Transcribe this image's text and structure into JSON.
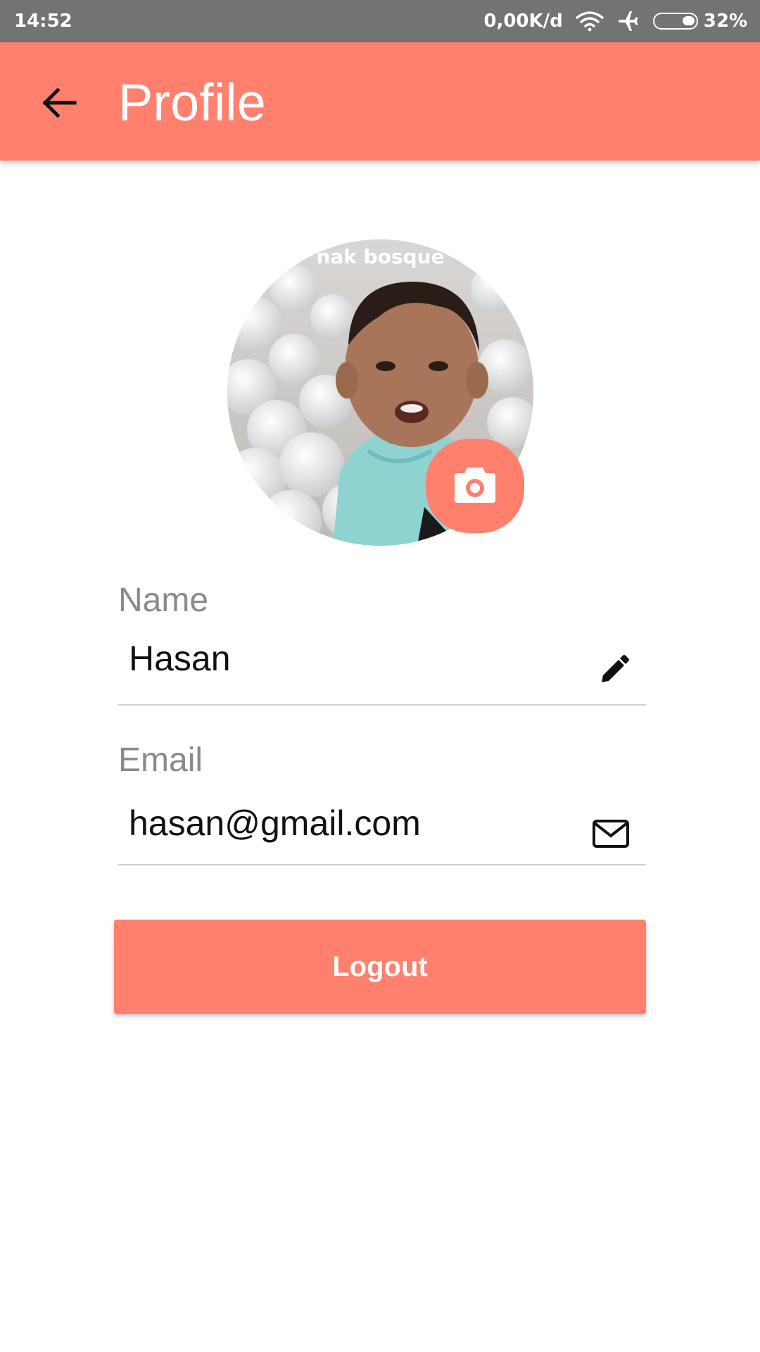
{
  "status_bar": {
    "time": "14:52",
    "network_speed": "0,00K/d",
    "battery_percent": "32%",
    "battery_level": 0.32,
    "icons": [
      "wifi-icon",
      "airplane-icon",
      "battery-icon"
    ]
  },
  "app_bar": {
    "title": "Profile",
    "back_icon": "arrow-left-icon",
    "color": "#ff806d"
  },
  "avatar": {
    "caption": "nak bosque",
    "camera_icon": "camera-icon"
  },
  "fields": {
    "name": {
      "label": "Name",
      "value": "Hasan",
      "icon": "pencil-icon"
    },
    "email": {
      "label": "Email",
      "value": "hasan@gmail.com",
      "icon": "mail-icon"
    }
  },
  "actions": {
    "logout_label": "Logout"
  },
  "colors": {
    "accent": "#ff806d",
    "status_bar": "#737373",
    "label": "#8a8a8a",
    "divider": "#cfcfcf"
  }
}
